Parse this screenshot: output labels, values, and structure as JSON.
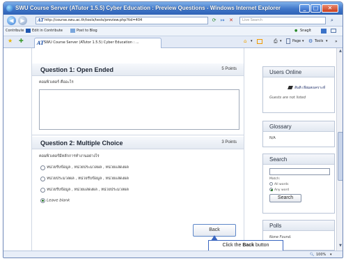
{
  "window": {
    "title": "SWU Course Server (ATutor 1.5.5) Cyber Education : Preview Questions - Windows Internet Explorer",
    "min_glyph": "_",
    "max_glyph": "□",
    "close_glyph": "✕"
  },
  "addressbar": {
    "back_glyph": "◀",
    "forward_glyph": "▶",
    "url": "http://course.swu.ac.th/tools/tests/preview.php?tid=404",
    "search_placeholder": "Live Search"
  },
  "linksbar": {
    "contribute": "Contribute",
    "edit_in_contribute": "Edit in Contribute",
    "post_to_blog": "Post to Blog",
    "snagit": "SnagIt"
  },
  "tabbar": {
    "tab_label": "SWU Course Server (ATutor 1.5.5) Cyber Education : ...",
    "page_menu": "Page",
    "tools_menu": "Tools"
  },
  "questions": [
    {
      "title": "Question 1:   Open Ended",
      "points": "5 Points",
      "text": "คอมพิวเตอร์ คืออะไร"
    },
    {
      "title": "Question 2:   Multiple Choice",
      "points": "3 Points",
      "text": "คอมพิวเตอร์มีหลักการทำงานอย่างไร",
      "options": [
        "หน่วยรับข้อมูล , หน่วยประมวลผล , หน่วยแสดงผล",
        "หน่วยประมวลผล , หน่วยรับข้อมูล , หน่วยแสดงผล",
        "หน่วยรับข้อมูล , หน่วยแสดงผล , หน่วยประมวลผล",
        "Leave blank"
      ],
      "selected_index": 3
    }
  ],
  "back_button": "Back",
  "callout": {
    "prefix": "Click the ",
    "bold": "Back",
    "suffix": " button"
  },
  "sidebar": {
    "users_online": {
      "title": "Users Online",
      "user": "สันติ เจียมสงเคราะห์",
      "guests": "Guests are not listed"
    },
    "glossary": {
      "title": "Glossary",
      "value": "N/A"
    },
    "search": {
      "title": "Search",
      "match_label": "Match:",
      "options": [
        "All words",
        "Any word"
      ],
      "selected_index": 1,
      "button": "Search"
    },
    "polls": {
      "title": "Polls",
      "value": "None Found."
    }
  },
  "status": {
    "zoom": "100%"
  }
}
